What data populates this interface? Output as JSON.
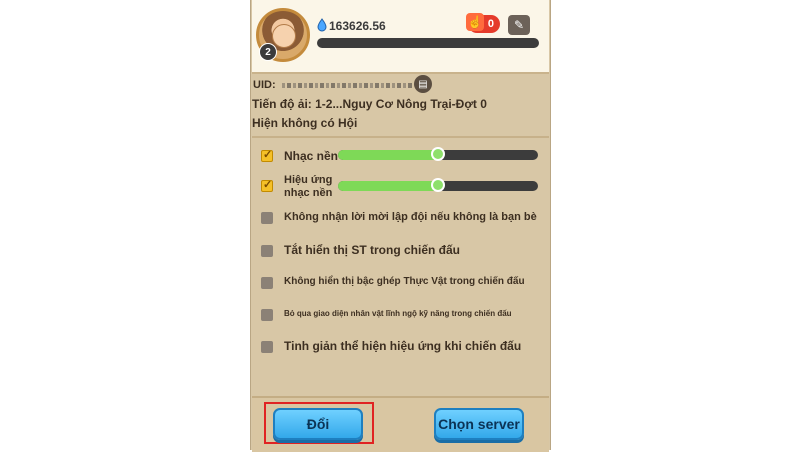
{
  "header": {
    "level": "2",
    "coin_value": "163626.56",
    "likes_count": "0",
    "icons": {
      "coin": "coin-icon",
      "like": "like-hand-icon",
      "edit": "edit-icon"
    }
  },
  "profile": {
    "uid_label": "UID:",
    "progress_text": "Tiến độ ải: 1-2...Nguy Cơ Nông Trại-Đợt 0",
    "guild_text": "Hiện không có Hội"
  },
  "settings": [
    {
      "label": "Nhạc nền",
      "checked": true,
      "slider": 0.5
    },
    {
      "label": "Hiệu ứng nhạc nền",
      "checked": true,
      "slider": 0.5
    },
    {
      "label": "Không nhận lời mời lập đội nếu không là bạn bè",
      "checked": false
    },
    {
      "label": "Tắt hiển thị ST trong chiến đấu",
      "checked": false
    },
    {
      "label": "Không hiển thị bậc ghép Thực Vật trong chiến đấu",
      "checked": false
    },
    {
      "label": "Bỏ qua giao diện  nhân vật lĩnh ngộ kỹ năng trong chiến đấu",
      "checked": false
    },
    {
      "label": "Tinh giản thể hiện hiệu ứng khi chiến đấu",
      "checked": false
    }
  ],
  "buttons": {
    "switch_label": "Đổi",
    "server_label": "Chọn server"
  },
  "colors": {
    "panel": "#d8c7a6",
    "header": "#fbf6e8",
    "slider_fill": "#7ed957",
    "button": "#33a8ea",
    "highlight": "#e02323"
  }
}
